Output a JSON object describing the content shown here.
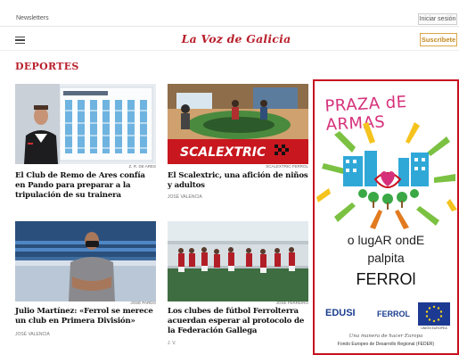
{
  "topbar": {
    "newsletters": "Newsletters",
    "login": "Iniciar sesión"
  },
  "header": {
    "logo": "La Voz de Galicia",
    "subscribe": "Suscríbete"
  },
  "section": {
    "title": "DEPORTES"
  },
  "articles": [
    {
      "title": "El Club de Remo de Ares confía en Pando para preparar a la tripulación de su trainera",
      "credit": "Z. R. DE ARES",
      "author": ""
    },
    {
      "title": "El Scalextric, una afición de niños y adultos",
      "credit": "SCALEXTRIC FERROL",
      "author": "JOSÉ VALENCIA"
    },
    {
      "title": "Julio Martínez: «Ferrol se merece un club en Primera División»",
      "credit": "JOSÉ PARDO",
      "author": "JOSÉ VALENCIA"
    },
    {
      "title": "Los clubes de fútbol Ferrolterra acuerdan esperar al protocolo de la Federación Gallega",
      "credit": "JOSÉ FERREIRO",
      "author": "J. V."
    }
  ],
  "ad": {
    "headline": "PRAZA dE ARMAS",
    "line1": "o lugAR ondE",
    "line2": "palpita",
    "line3": "FERROl",
    "logo_edusi": "EDUSI",
    "logo_ferrol": "FERROL",
    "eu_label": "UNIÓN EUROPEA",
    "motto": "Una manera de hacer Europa",
    "fund": "Fondo Europeo de Desarrollo Regional (FEDER)"
  },
  "colors": {
    "brand": "#b81f2b",
    "subscribe": "#c28a22",
    "ad_border": "#c8101e"
  }
}
